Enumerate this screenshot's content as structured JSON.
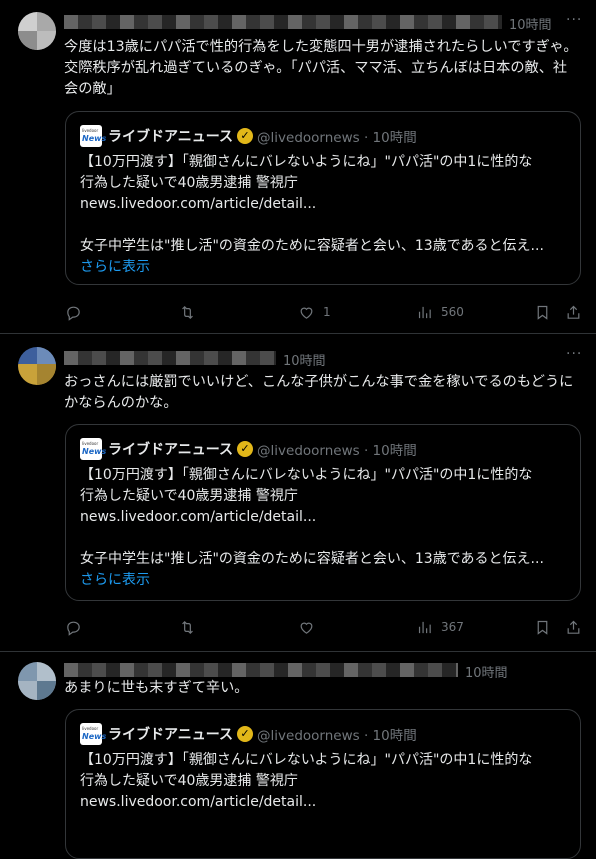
{
  "tweets": [
    {
      "time": "10時間",
      "text": "今度は13歳にパパ活で性的行為をした変態四十男が逮捕されたらしいですぎゃ。交際秩序が乱れ過ぎているのぎゃ。「パパ活、ママ活、立ちんぼは日本の敵、社会の敵」",
      "card": {
        "logo_top": "livedoor",
        "logo_bottom": "News",
        "source": "ライブドアニュース",
        "handle": "@livedoornews · 10時間",
        "line1": "【10万円渡す】「親御さんにバレないようにね」\"パパ活\"の中1に性的な",
        "line2": "行為した疑いで40歳男逮捕 警視庁",
        "line3": "news.livedoor.com/article/detail...",
        "line4": "女子中学生は\"推し活\"の資金のために容疑者と会い、13歳であると伝え...",
        "show_more": "さらに表示"
      },
      "likes": "1",
      "views": "560"
    },
    {
      "time": "10時間",
      "text": "おっさんには厳罰でいいけど、こんな子供がこんな事で金を稼いでるのもどうにかならんのかな。",
      "card": {
        "logo_top": "livedoor",
        "logo_bottom": "News",
        "source": "ライブドアニュース",
        "handle": "@livedoornews · 10時間",
        "line1": "【10万円渡す】「親御さんにバレないようにね」\"パパ活\"の中1に性的な",
        "line2": "行為した疑いで40歳男逮捕 警視庁",
        "line3": "news.livedoor.com/article/detail...",
        "line4": "女子中学生は\"推し活\"の資金のために容疑者と会い、13歳であると伝え...",
        "show_more": "さらに表示"
      },
      "likes": "",
      "views": "367"
    },
    {
      "time": "10時間",
      "text": "あまりに世も末すぎて辛い。",
      "card": {
        "logo_top": "livedoor",
        "logo_bottom": "News",
        "source": "ライブドアニュース",
        "handle": "@livedoornews · 10時間",
        "line1": "【10万円渡す】「親御さんにバレないようにね」\"パパ活\"の中1に性的な",
        "line2": "行為した疑いで40歳男逮捕 警視庁",
        "line3": "news.livedoor.com/article/detail..."
      }
    }
  ],
  "more_icon": "···",
  "verified_icon": "✓",
  "colors": {
    "background": "#000000",
    "link": "#1d9bf0",
    "muted": "#71767b",
    "verified": "#e2b719"
  }
}
